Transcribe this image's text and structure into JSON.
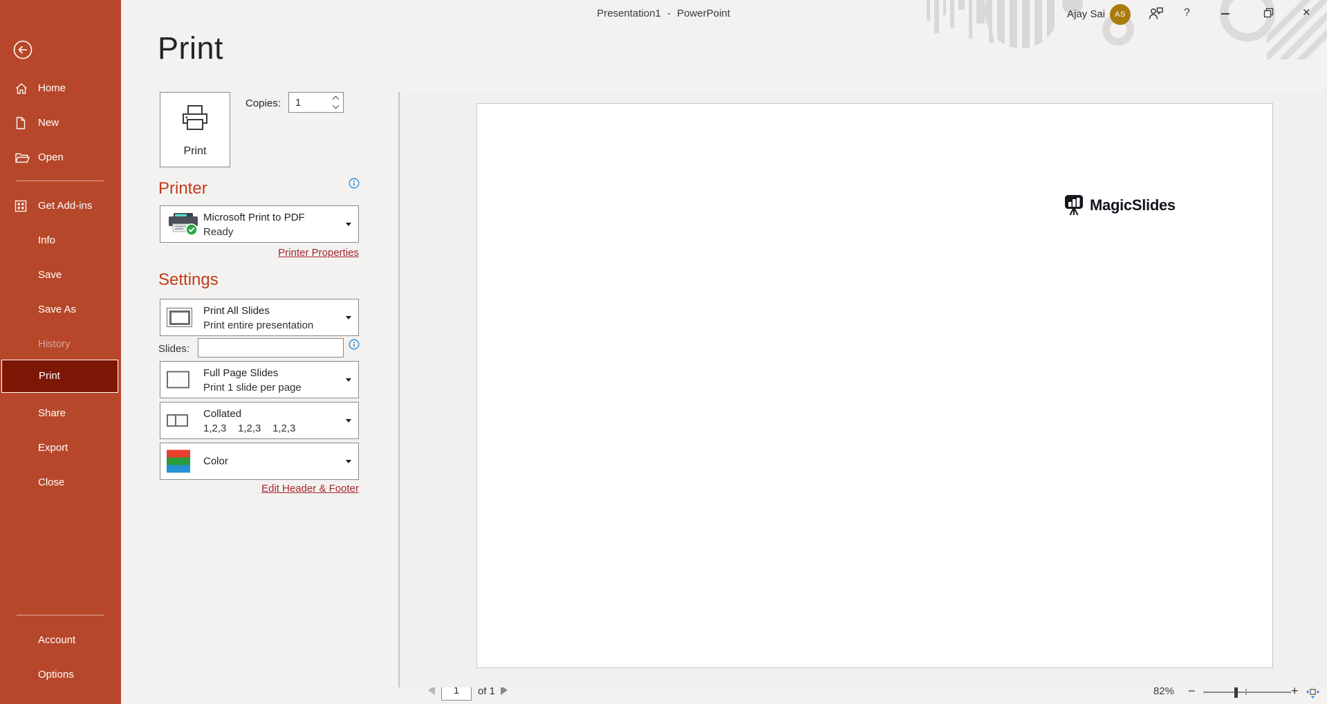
{
  "titlebar": {
    "app_title": "Presentation1 - PowerPoint",
    "user_name": "Ajay Sai",
    "user_initials": "AS",
    "help_label": "?",
    "close_glyph": "✕"
  },
  "sidebar": {
    "items": [
      {
        "label": "Home"
      },
      {
        "label": "New"
      },
      {
        "label": "Open"
      },
      {
        "label": "Get Add-ins"
      },
      {
        "label": "Info"
      },
      {
        "label": "Save"
      },
      {
        "label": "Save As"
      },
      {
        "label": "History"
      },
      {
        "label": "Print"
      },
      {
        "label": "Share"
      },
      {
        "label": "Export"
      },
      {
        "label": "Close"
      },
      {
        "label": "Account"
      },
      {
        "label": "Options"
      }
    ]
  },
  "main": {
    "page_title": "Print",
    "print_button_label": "Print",
    "copies_label": "Copies:",
    "copies_value": "1",
    "printer": {
      "heading": "Printer",
      "name": "Microsoft Print to PDF",
      "status": "Ready",
      "properties_link": "Printer Properties"
    },
    "settings": {
      "heading": "Settings",
      "slides_label": "Slides:",
      "slides_value": "",
      "dropdowns": [
        {
          "line1": "Print All Slides",
          "line2": "Print entire presentation"
        },
        {
          "line1": "Full Page Slides",
          "line2": "Print 1 slide per page"
        },
        {
          "line1": "Collated",
          "line2": "1,2,3    1,2,3    1,2,3"
        },
        {
          "line1": "Color",
          "line2": ""
        }
      ],
      "header_footer_link": "Edit Header & Footer"
    }
  },
  "preview": {
    "slide_logo_text": "MagicSlides"
  },
  "statusbar": {
    "page_value": "1",
    "page_of_label": "of 1",
    "zoom_percent": "82%",
    "zoom_minus": "−",
    "zoom_plus": "+"
  },
  "colors": {
    "sidebar_bg": "#b7472a",
    "sidebar_selected_bg": "#7c1705",
    "section_heading": "#c13b17",
    "link": "#a4262c",
    "info_icon": "#2488d8",
    "avatar_bg": "#a87b0b",
    "printer_check_green": "#28a745",
    "color_icon_red": "#e8402f",
    "color_icon_green": "#2a9a3d",
    "color_icon_blue": "#2592d4"
  }
}
